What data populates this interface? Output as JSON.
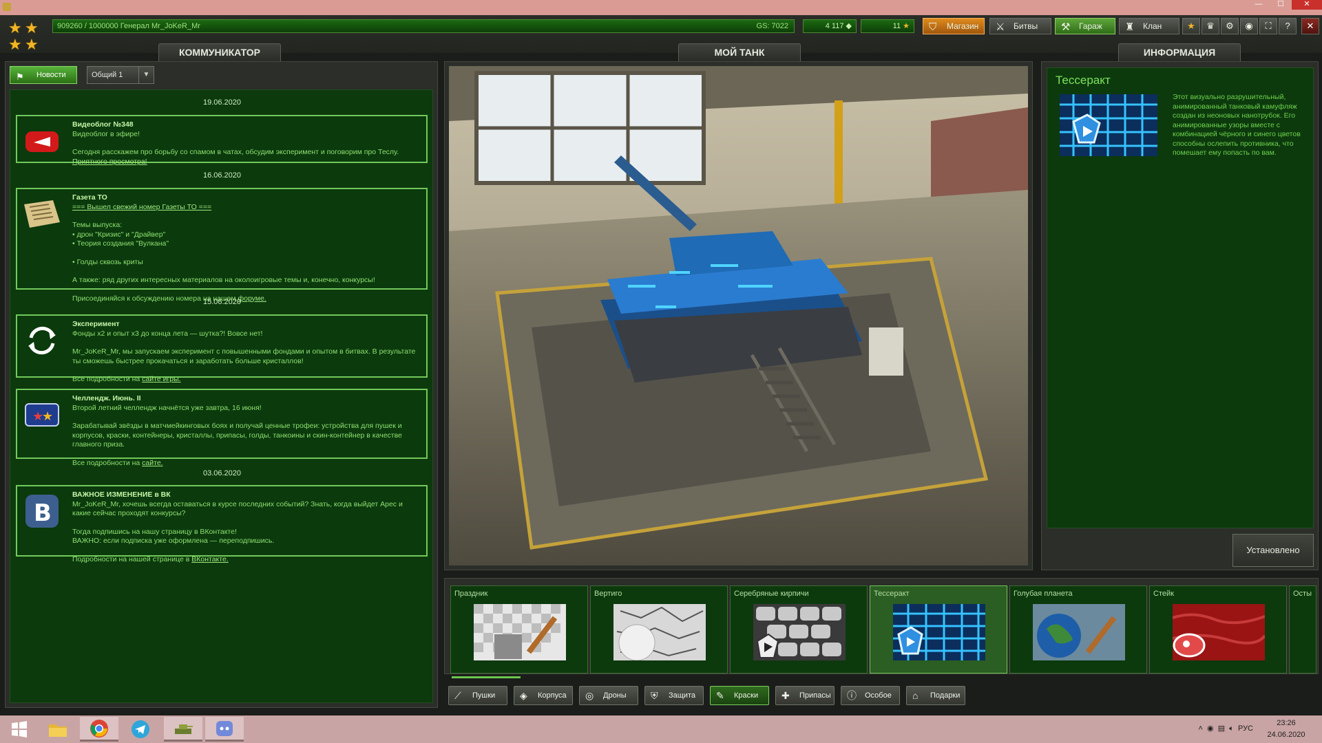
{
  "window": {
    "minimize": "—",
    "maximize": "☐",
    "close": "✕"
  },
  "topbar": {
    "xp_text": "909260 / 1000000  Генерал Mr_JoKeR_Mr",
    "gs_text": "GS: 7022",
    "crystals": "4 117",
    "stars_count": "11",
    "nav": {
      "shop": "Магазин",
      "battles": "Битвы",
      "garage": "Гараж",
      "clan": "Клан"
    },
    "icon_buttons": [
      "star-icon",
      "achievements-icon",
      "settings-icon",
      "sound-icon",
      "fullscreen-icon",
      "help-icon",
      "close-icon"
    ]
  },
  "tabs": {
    "communicator": "КОММУНИКАТОР",
    "my_tank": "МОЙ ТАНК",
    "info": "ИНФОРМАЦИЯ"
  },
  "communicator": {
    "news_button": "Новости",
    "channel": "Общий 1",
    "dates": [
      "19.06.2020",
      "16.06.2020",
      "15.06.2020",
      "03.06.2020"
    ],
    "news": [
      {
        "title": "Видеоблог №348",
        "line1": "Видеоблог в эфире!",
        "line2": "Сегодня расскажем про борьбу со спамом в чатах, обсудим эксперимент и поговорим про Теслу. ",
        "link": "Приятного просмотра!"
      },
      {
        "title": "Газета ТО",
        "link_top": "=== Вышел свежий номер Газеты ТО ===",
        "l1": "Темы выпуска:",
        "l2": "• дрон \"Кризис\" и \"Драйвер\"",
        "l3": "• Теория создания \"Вулкана\"",
        "l4": "• Голды сквозь криты",
        "l5": "А также: ряд других интересных материалов на околоигровые темы и, конечно, конкурсы!",
        "l6": "Присоединяйся к обсуждению номера на нашем ",
        "link": "форуме."
      },
      {
        "title": "Эксперимент",
        "line1": "Фонды x2 и опыт x3 до конца лета — шутка?! Вовсе нет!",
        "line2": "Mr_JoKeR_Mr, мы запускаем эксперимент с повышенными фондами и опытом в битвах. В результате ты сможешь быстрее прокачаться и заработать больше кристаллов!",
        "line3": "Все подробности на ",
        "link": "сайте игры."
      },
      {
        "title": "Челлендж. Июнь. II",
        "line1": "Второй летний челлендж начнётся уже завтра, 16 июня!",
        "line2": "Зарабатывай звёзды в матчмейкинговых боях и получай ценные трофеи: устройства для пушек и корпусов, краски, контейнеры, кристаллы, припасы, голды, танкоины и скин-контейнер в качестве главного приза.",
        "line3": "Все подробности на  ",
        "link": "сайте."
      },
      {
        "title": "ВАЖНОЕ ИЗМЕНЕНИЕ в ВК",
        "line1": "Mr_JoKeR_Mr, хочешь всегда оставаться в курсе последних событий? Знать, когда выйдет Арес и какие сейчас проходят конкурсы?",
        "line2": "Тогда подпишись на нашу страницу в ВКонтакте!",
        "line3": "ВАЖНО: если подписка уже оформлена — переподпишись.",
        "line4": "Подробности на нашей странице в ",
        "link": "ВКонтакте."
      }
    ]
  },
  "info": {
    "title": "Тессеракт",
    "description": "Этот визуально разрушительный, анимированный танковый камуфляж создан из неоновых нанотрубок. Его анимированные узоры вместе с комбинацией чёрного и синего цветов способны ослепить противника, что помешает ему попасть по вам.",
    "installed_button": "Установлено"
  },
  "items": [
    "Праздник",
    "Вертиго",
    "Серебряные кирпичи",
    "Тессеракт",
    "Голубая планета",
    "Стейк",
    "Осты"
  ],
  "scroll_progress": 0.08,
  "categories": [
    "Пушки",
    "Корпуса",
    "Дроны",
    "Защита",
    "Краски",
    "Припасы",
    "Особое",
    "Подарки"
  ],
  "taskbar": {
    "apps": [
      "windows-start-icon",
      "file-explorer-icon",
      "chrome-icon",
      "telegram-icon",
      "tanki-online-icon",
      "discord-icon"
    ],
    "lang": "РУС",
    "time": "23:26",
    "date": "24.06.2020"
  },
  "colors": {
    "accent_green": "#73c95a",
    "panel_bg": "#0c3a0d",
    "shop_orange": "#e08b1f"
  }
}
